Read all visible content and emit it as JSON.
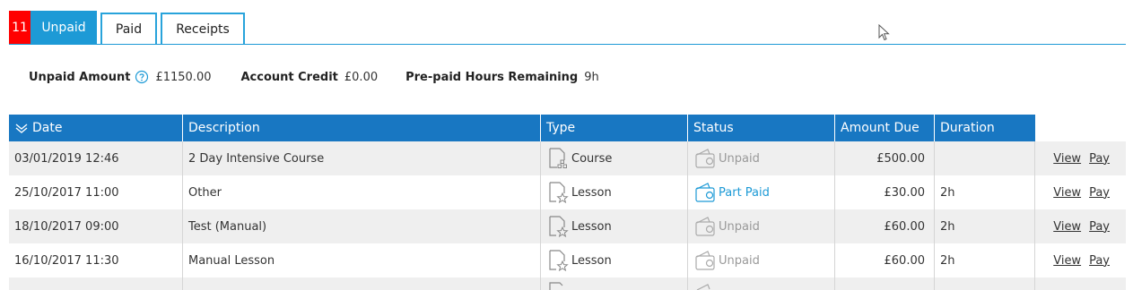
{
  "tabs": {
    "badge": "11",
    "unpaid": "Unpaid",
    "paid": "Paid",
    "receipts": "Receipts"
  },
  "summary": {
    "unpaid_amount_label": "Unpaid Amount",
    "unpaid_amount_value": "£1150.00",
    "account_credit_label": "Account Credit",
    "account_credit_value": "£0.00",
    "prepaid_label": "Pre-paid Hours Remaining",
    "prepaid_value": "9h"
  },
  "table": {
    "headers": [
      "Date",
      "Description",
      "Type",
      "Status",
      "Amount Due",
      "Duration"
    ],
    "rows": [
      {
        "date": "03/01/2019 12:46",
        "description": "2 Day Intensive Course",
        "type": "Course",
        "status": "Unpaid",
        "amount": "£500.00",
        "duration": "",
        "view": "View",
        "pay": "Pay"
      },
      {
        "date": "25/10/2017 11:00",
        "description": "Other",
        "type": "Lesson",
        "status": "Part Paid",
        "amount": "£30.00",
        "duration": "2h",
        "view": "View",
        "pay": "Pay"
      },
      {
        "date": "18/10/2017 09:00",
        "description": "Test (Manual)",
        "type": "Lesson",
        "status": "Unpaid",
        "amount": "£60.00",
        "duration": "2h",
        "view": "View",
        "pay": "Pay"
      },
      {
        "date": "16/10/2017 11:30",
        "description": "Manual Lesson",
        "type": "Lesson",
        "status": "Unpaid",
        "amount": "£60.00",
        "duration": "2h",
        "view": "View",
        "pay": "Pay"
      }
    ]
  },
  "colors": {
    "accent": "#1d9ad6",
    "header": "#1877c2",
    "badge": "#ff0000",
    "row_alt": "#efefef"
  },
  "icons": {
    "course": "course-doc-icon",
    "lesson": "lesson-doc-star-icon",
    "wallet": "wallet-icon",
    "help": "help-icon",
    "sort": "chevron-down-icon"
  }
}
